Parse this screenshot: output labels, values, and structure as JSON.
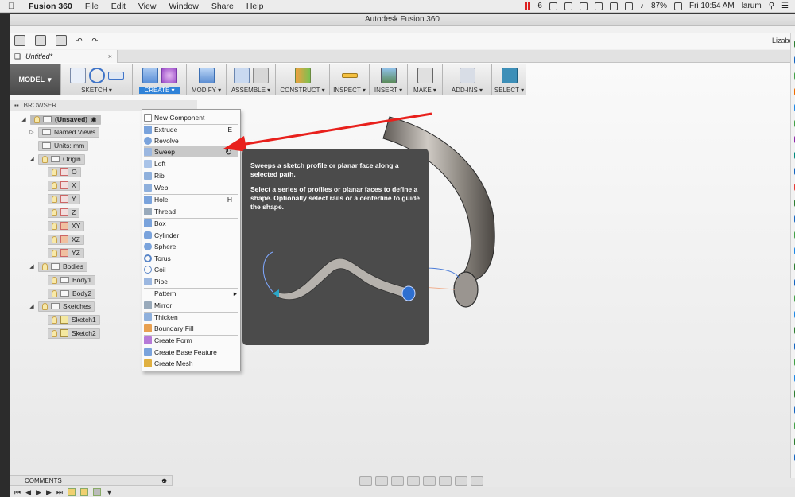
{
  "menubar": {
    "app_name": "Fusion 360",
    "items": [
      "File",
      "Edit",
      "View",
      "Window",
      "Share",
      "Help"
    ],
    "status": {
      "badge": "6",
      "battery": "87%",
      "clock": "Fri 10:54 AM",
      "user": "larum"
    }
  },
  "window": {
    "title": "Autodesk Fusion 360",
    "user": "Lizabet",
    "doc_tab": "Untitled*"
  },
  "toolbar": {
    "workspace": "MODEL",
    "groups": [
      {
        "label": "SKETCH ▾",
        "icons": [
          "sketch-icon",
          "spline-icon",
          "rectangle-icon"
        ]
      },
      {
        "label": "CREATE ▾",
        "icons": [
          "extrude-icon",
          "form-icon"
        ],
        "active": true
      },
      {
        "label": "MODIFY ▾",
        "icons": [
          "press-pull-icon"
        ]
      },
      {
        "label": "ASSEMBLE ▾",
        "icons": [
          "component-icon",
          "joint-icon"
        ]
      },
      {
        "label": "CONSTRUCT ▾",
        "icons": [
          "plane-icon"
        ]
      },
      {
        "label": "INSPECT ▾",
        "icons": [
          "measure-icon"
        ]
      },
      {
        "label": "INSERT ▾",
        "icons": [
          "image-icon"
        ]
      },
      {
        "label": "MAKE ▾",
        "icons": [
          "print-icon"
        ]
      },
      {
        "label": "ADD-INS ▾",
        "icons": [
          "scripts-icon"
        ]
      },
      {
        "label": "SELECT ▾",
        "icons": [
          "select-icon"
        ]
      }
    ]
  },
  "browser": {
    "header": "BROWSER",
    "nodes": [
      {
        "label": "(Unsaved)"
      },
      {
        "label": "Named Views"
      },
      {
        "label": "Units: mm"
      },
      {
        "label": "Origin"
      },
      {
        "label": "O"
      },
      {
        "label": "X"
      },
      {
        "label": "Y"
      },
      {
        "label": "Z"
      },
      {
        "label": "XY"
      },
      {
        "label": "XZ"
      },
      {
        "label": "YZ"
      },
      {
        "label": "Bodies"
      },
      {
        "label": "Body1"
      },
      {
        "label": "Body2"
      },
      {
        "label": "Sketches"
      },
      {
        "label": "Sketch1"
      },
      {
        "label": "Sketch2"
      }
    ]
  },
  "create_menu": {
    "items": [
      {
        "label": "New Component",
        "shortcut": ""
      },
      {
        "label": "Extrude",
        "shortcut": "E"
      },
      {
        "label": "Revolve",
        "shortcut": ""
      },
      {
        "label": "Sweep",
        "shortcut": ""
      },
      {
        "label": "Loft",
        "shortcut": ""
      },
      {
        "label": "Rib",
        "shortcut": ""
      },
      {
        "label": "Web",
        "shortcut": ""
      },
      {
        "label": "Hole",
        "shortcut": "H"
      },
      {
        "label": "Thread",
        "shortcut": ""
      },
      {
        "label": "Box",
        "shortcut": ""
      },
      {
        "label": "Cylinder",
        "shortcut": ""
      },
      {
        "label": "Sphere",
        "shortcut": ""
      },
      {
        "label": "Torus",
        "shortcut": ""
      },
      {
        "label": "Coil",
        "shortcut": ""
      },
      {
        "label": "Pipe",
        "shortcut": ""
      },
      {
        "label": "Pattern",
        "shortcut": "▸"
      },
      {
        "label": "Mirror",
        "shortcut": ""
      },
      {
        "label": "Thicken",
        "shortcut": ""
      },
      {
        "label": "Boundary Fill",
        "shortcut": ""
      },
      {
        "label": "Create Form",
        "shortcut": ""
      },
      {
        "label": "Create Base Feature",
        "shortcut": ""
      },
      {
        "label": "Create Mesh",
        "shortcut": ""
      }
    ],
    "highlighted": "Sweep"
  },
  "tooltip": {
    "line1": "Sweeps a sketch profile or planar face along a selected path.",
    "line2": "Select a series of profiles or planar faces to define a shape. Optionally select rails or a centerline to guide the shape."
  },
  "comments": {
    "label": "COMMENTS"
  },
  "colors": {
    "accent": "#2f82d8",
    "tooltip_bg": "#4b4b4b",
    "arrow": "#e8201c"
  }
}
